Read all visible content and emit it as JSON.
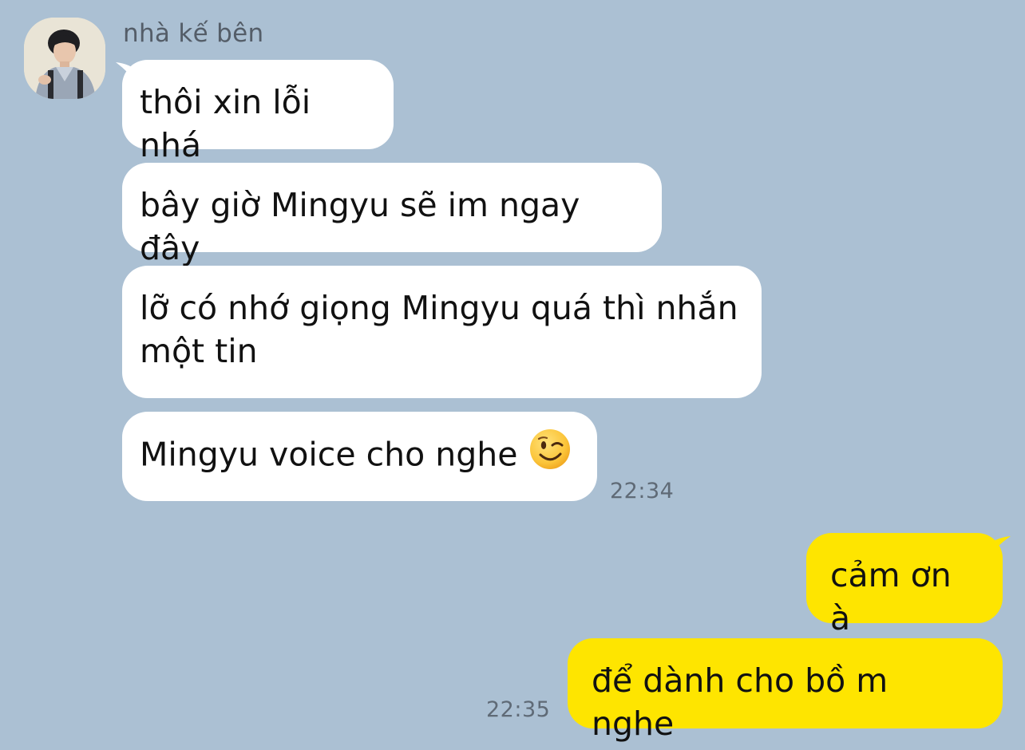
{
  "chat": {
    "sender_name": "nhà kế bên",
    "incoming_messages": [
      "thôi xin lỗi nhá",
      "bây giờ Mingyu sẽ im ngay đây",
      "lỡ có nhớ giọng Mingyu quá thì nhắn một tin",
      "Mingyu voice cho nghe"
    ],
    "incoming_time": "22:34",
    "outgoing_messages": [
      "cảm ơn à",
      "để dành cho bồ m nghe"
    ],
    "outgoing_time": "22:35"
  },
  "icons": {
    "emoji": "winking-face-emoji",
    "avatar": "profile-photo"
  },
  "colors": {
    "background": "#abc0d3",
    "incoming_bubble": "#ffffff",
    "outgoing_bubble": "#fee500",
    "timestamp_text": "#5f6a76"
  }
}
